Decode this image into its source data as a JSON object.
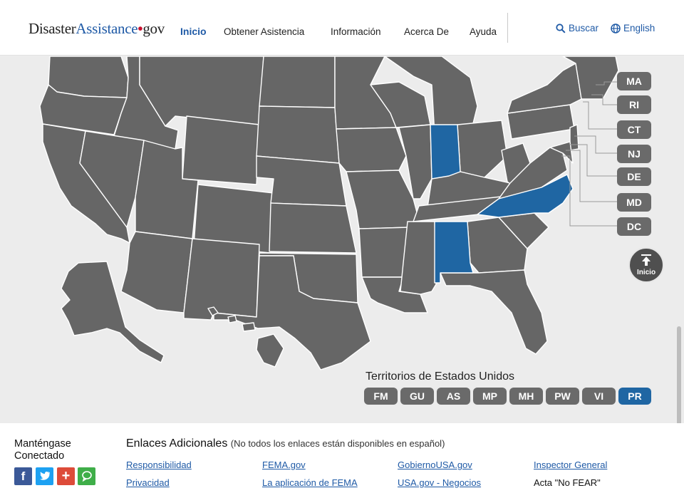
{
  "header": {
    "logo": {
      "part1": "Disaster",
      "part2": "Assistance",
      "dot": "•",
      "part3": "gov"
    },
    "nav": [
      {
        "label": "Inicio",
        "active": true
      },
      {
        "label": "Obtener Asistencia"
      },
      {
        "label": "Información"
      },
      {
        "label": "Acerca De"
      },
      {
        "label": "Ayuda"
      }
    ],
    "search_label": "Buscar",
    "language_label": "English"
  },
  "map": {
    "colors": {
      "land": "#666666",
      "highlight": "#1f66a3",
      "border": "#ffffff",
      "background": "#ececec"
    },
    "highlighted_states": [
      "Indiana",
      "Alabama",
      "North Carolina"
    ],
    "small_states": [
      "MA",
      "RI",
      "CT",
      "NJ",
      "DE",
      "MD",
      "DC"
    ],
    "back_to_top_label": "Inicio",
    "territories": {
      "title": "Territorios de Estados Unidos",
      "items": [
        "FM",
        "GU",
        "AS",
        "MP",
        "MH",
        "PW",
        "VI",
        "PR"
      ],
      "selected": "PR"
    }
  },
  "footer": {
    "stay_connected": "Manténgase Conectado",
    "social": [
      {
        "icon": "facebook-icon",
        "glyph": "f",
        "color": "#3b5998"
      },
      {
        "icon": "twitter-icon",
        "glyph": "t",
        "color": "#1da1f2"
      },
      {
        "icon": "google-plus-icon",
        "glyph": "+",
        "color": "#dd4b39"
      },
      {
        "icon": "chat-icon",
        "glyph": "◯",
        "color": "#3fae49"
      }
    ],
    "additional_links_title": "Enlaces Adicionales",
    "additional_links_note": "(No todos los enlaces están disponibles en español)",
    "links": [
      {
        "label": "Responsibilidad"
      },
      {
        "label": "FEMA.gov"
      },
      {
        "label": "GobiernoUSA.gov"
      },
      {
        "label": "Inspector General"
      },
      {
        "label": "Privacidad"
      },
      {
        "label": "La aplicación de FEMA"
      },
      {
        "label": "USA.gov - Negocios"
      },
      {
        "label": "Acta \"No FEAR\""
      }
    ]
  }
}
